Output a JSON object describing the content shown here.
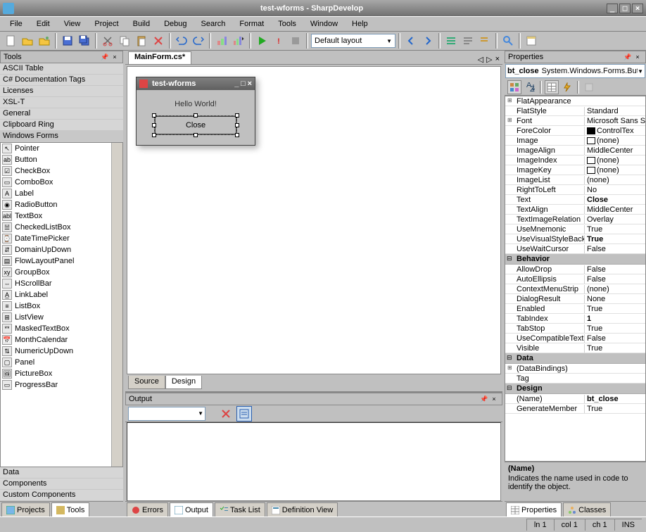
{
  "titlebar": {
    "title": "test-wforms - SharpDevelop"
  },
  "menu": [
    "File",
    "Edit",
    "View",
    "Project",
    "Build",
    "Debug",
    "Search",
    "Format",
    "Tools",
    "Window",
    "Help"
  ],
  "toolbar": {
    "layout_combo": "Default layout"
  },
  "tools_panel": {
    "title": "Tools",
    "categories": [
      "ASCII Table",
      "C# Documentation Tags",
      "Licenses",
      "XSL-T",
      "General",
      "Clipboard Ring",
      "Windows Forms"
    ],
    "items": [
      "Pointer",
      "Button",
      "CheckBox",
      "ComboBox",
      "Label",
      "RadioButton",
      "TextBox",
      "CheckedListBox",
      "DateTimePicker",
      "DomainUpDown",
      "FlowLayoutPanel",
      "GroupBox",
      "HScrollBar",
      "LinkLabel",
      "ListBox",
      "ListView",
      "MaskedTextBox",
      "MonthCalendar",
      "NumericUpDown",
      "Panel",
      "PictureBox",
      "ProgressBar"
    ],
    "more_categories": [
      "Data",
      "Components",
      "Custom Components"
    ],
    "footer_tabs": [
      "Projects",
      "Tools"
    ]
  },
  "editor": {
    "tab": "MainForm.cs*",
    "form_title": "test-wforms",
    "label_text": "Hello World!",
    "button_text": "Close",
    "source_tab": "Source",
    "design_tab": "Design"
  },
  "output_panel": {
    "title": "Output",
    "footer_tabs": [
      "Errors",
      "Output",
      "Task List",
      "Definition View"
    ]
  },
  "properties": {
    "title": "Properties",
    "object_name": "bt_close",
    "object_type": "System.Windows.Forms.Button",
    "rows": [
      {
        "cat": "_appearance_cont"
      },
      {
        "n": "FlatAppearance",
        "v": "",
        "exp": true
      },
      {
        "n": "FlatStyle",
        "v": "Standard"
      },
      {
        "n": "Font",
        "v": "Microsoft Sans S",
        "exp": true
      },
      {
        "n": "ForeColor",
        "v": "ControlTex",
        "swatch": "#000000"
      },
      {
        "n": "Image",
        "v": "(none)",
        "swatch": "#ffffff"
      },
      {
        "n": "ImageAlign",
        "v": "MiddleCenter"
      },
      {
        "n": "ImageIndex",
        "v": "(none)",
        "swatch": "#ffffff"
      },
      {
        "n": "ImageKey",
        "v": "(none)",
        "swatch": "#ffffff"
      },
      {
        "n": "ImageList",
        "v": "(none)"
      },
      {
        "n": "RightToLeft",
        "v": "No"
      },
      {
        "n": "Text",
        "v": "Close",
        "bold": true
      },
      {
        "n": "TextAlign",
        "v": "MiddleCenter"
      },
      {
        "n": "TextImageRelation",
        "v": "Overlay"
      },
      {
        "n": "UseMnemonic",
        "v": "True"
      },
      {
        "n": "UseVisualStyleBackCol",
        "v": "True",
        "bold": true
      },
      {
        "n": "UseWaitCursor",
        "v": "False"
      },
      {
        "cat": "Behavior"
      },
      {
        "n": "AllowDrop",
        "v": "False"
      },
      {
        "n": "AutoEllipsis",
        "v": "False"
      },
      {
        "n": "ContextMenuStrip",
        "v": "(none)"
      },
      {
        "n": "DialogResult",
        "v": "None"
      },
      {
        "n": "Enabled",
        "v": "True"
      },
      {
        "n": "TabIndex",
        "v": "1",
        "bold": true
      },
      {
        "n": "TabStop",
        "v": "True"
      },
      {
        "n": "UseCompatibleTextRen",
        "v": "False"
      },
      {
        "n": "Visible",
        "v": "True"
      },
      {
        "cat": "Data"
      },
      {
        "n": "(DataBindings)",
        "v": "",
        "exp": true
      },
      {
        "n": "Tag",
        "v": ""
      },
      {
        "cat": "Design"
      },
      {
        "n": "(Name)",
        "v": "bt_close",
        "bold": true
      },
      {
        "n": "GenerateMember",
        "v": "True"
      }
    ],
    "desc_title": "(Name)",
    "desc_text": "Indicates the name used in code to identify the object.",
    "footer_tabs": [
      "Properties",
      "Classes"
    ]
  },
  "statusbar": {
    "line": "ln 1",
    "col": "col 1",
    "ch": "ch 1",
    "ins": "INS"
  }
}
